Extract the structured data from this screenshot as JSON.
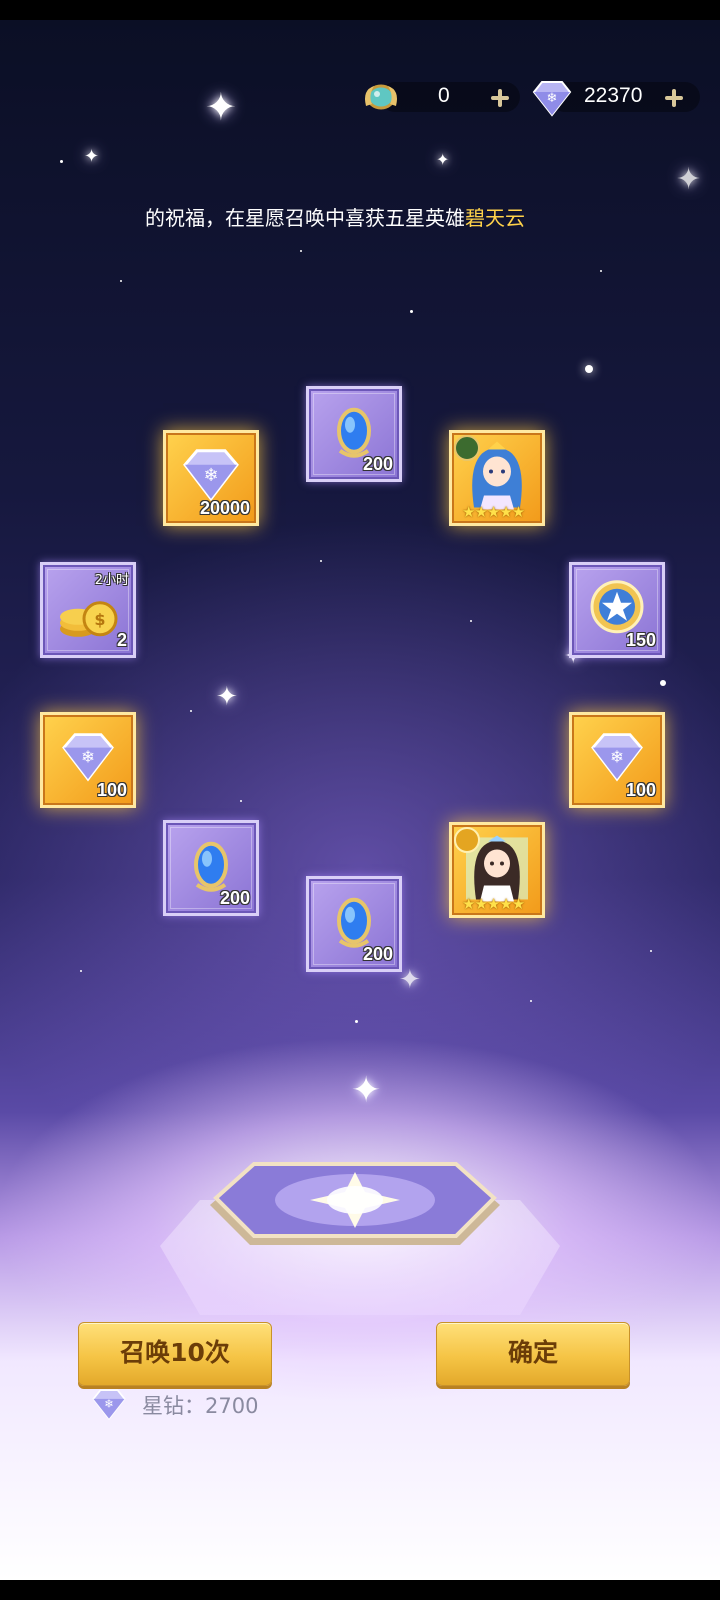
{
  "currency": {
    "coin": {
      "icon": "dragon-egg-icon",
      "value": "0"
    },
    "diamond": {
      "icon": "star-diamond-icon",
      "value": "22370"
    }
  },
  "marquee": {
    "text": "的祝福，在星愿召唤中喜获五星英雄",
    "highlight": "碧天云"
  },
  "rewards": [
    {
      "id": "diamond-20000",
      "icon": "star-diamond-icon",
      "count": "20000",
      "rarity": "gold"
    },
    {
      "id": "blue-gem-top",
      "icon": "blue-gem-icon",
      "count": "200",
      "rarity": "purple"
    },
    {
      "id": "hero-blue",
      "icon": "hero-portrait-blue-hair",
      "stars": "★★★★★",
      "rarity": "gold"
    },
    {
      "id": "gold-coins",
      "icon": "gold-coins-icon",
      "count": "2",
      "tag": "2小时",
      "rarity": "purple"
    },
    {
      "id": "star-medal",
      "icon": "star-medal-icon",
      "count": "150",
      "rarity": "purple"
    },
    {
      "id": "diamond-100-left",
      "icon": "star-diamond-icon",
      "count": "100",
      "rarity": "gold"
    },
    {
      "id": "diamond-100-right",
      "icon": "star-diamond-icon",
      "count": "100",
      "rarity": "gold"
    },
    {
      "id": "blue-gem-left",
      "icon": "blue-gem-icon",
      "count": "200",
      "rarity": "purple"
    },
    {
      "id": "hero-dark",
      "icon": "hero-portrait-dark-hair",
      "stars": "★★★★★",
      "rarity": "gold"
    },
    {
      "id": "blue-gem-bottom",
      "icon": "blue-gem-icon",
      "count": "200",
      "rarity": "purple"
    }
  ],
  "buttons": {
    "summon10": "召唤10次",
    "confirm": "确定"
  },
  "cost": {
    "icon": "star-diamond-icon",
    "label": "星钻：2700"
  }
}
